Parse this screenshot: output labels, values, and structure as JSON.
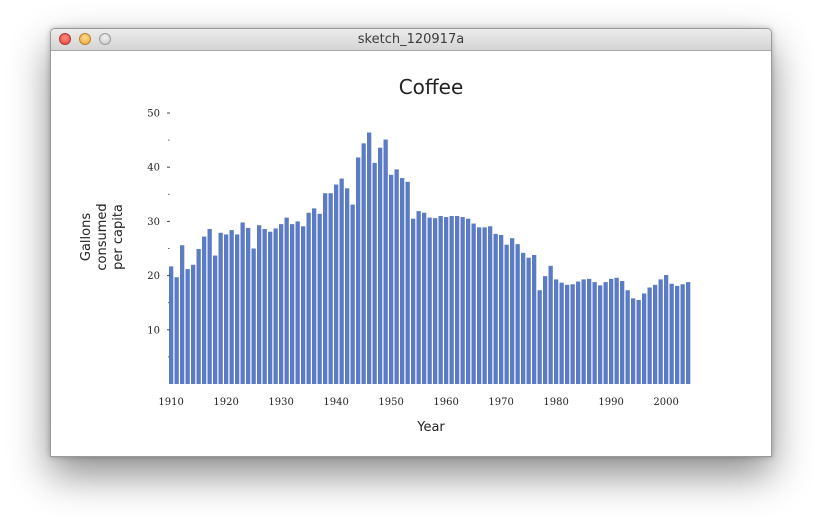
{
  "window": {
    "title": "sketch_120917a"
  },
  "colors": {
    "bar": "#5b7cc4",
    "axis": "#333333"
  },
  "chart_data": {
    "type": "bar",
    "title": "Coffee",
    "xlabel": "Year",
    "ylabel_lines": [
      "Gallons",
      "consumed",
      "per capita"
    ],
    "ylim": [
      0,
      50
    ],
    "y_ticks": [
      10,
      20,
      30,
      40,
      50
    ],
    "y_minor_ticks": [
      5,
      15,
      25,
      35,
      45
    ],
    "x_ticks": [
      1910,
      1920,
      1930,
      1940,
      1950,
      1960,
      1970,
      1980,
      1990,
      2000
    ],
    "grid": false,
    "x_start": 1910,
    "values": [
      21.7,
      19.7,
      25.6,
      21.2,
      22.0,
      24.9,
      27.2,
      28.6,
      23.7,
      27.9,
      27.6,
      28.4,
      27.6,
      29.8,
      28.8,
      25.0,
      29.3,
      28.6,
      28.1,
      28.7,
      29.5,
      30.7,
      29.5,
      30.0,
      29.1,
      31.6,
      32.4,
      31.4,
      35.2,
      35.2,
      36.8,
      37.9,
      36.1,
      33.1,
      41.8,
      44.4,
      46.4,
      40.8,
      43.6,
      45.1,
      38.6,
      39.6,
      38.0,
      37.3,
      30.5,
      31.9,
      31.6,
      30.7,
      30.6,
      31.0,
      30.8,
      31.0,
      31.0,
      30.8,
      30.5,
      29.6,
      28.9,
      28.9,
      29.1,
      27.7,
      27.5,
      25.7,
      26.9,
      25.8,
      24.2,
      23.3,
      23.8,
      17.3,
      19.9,
      21.8,
      19.3,
      18.7,
      18.3,
      18.4,
      18.9,
      19.3,
      19.4,
      18.8,
      18.2,
      18.8,
      19.4,
      19.6,
      19.0,
      17.3,
      15.8,
      15.5,
      16.7,
      17.8,
      18.3,
      19.3,
      20.1,
      18.5,
      18.1,
      18.4,
      18.8
    ]
  }
}
